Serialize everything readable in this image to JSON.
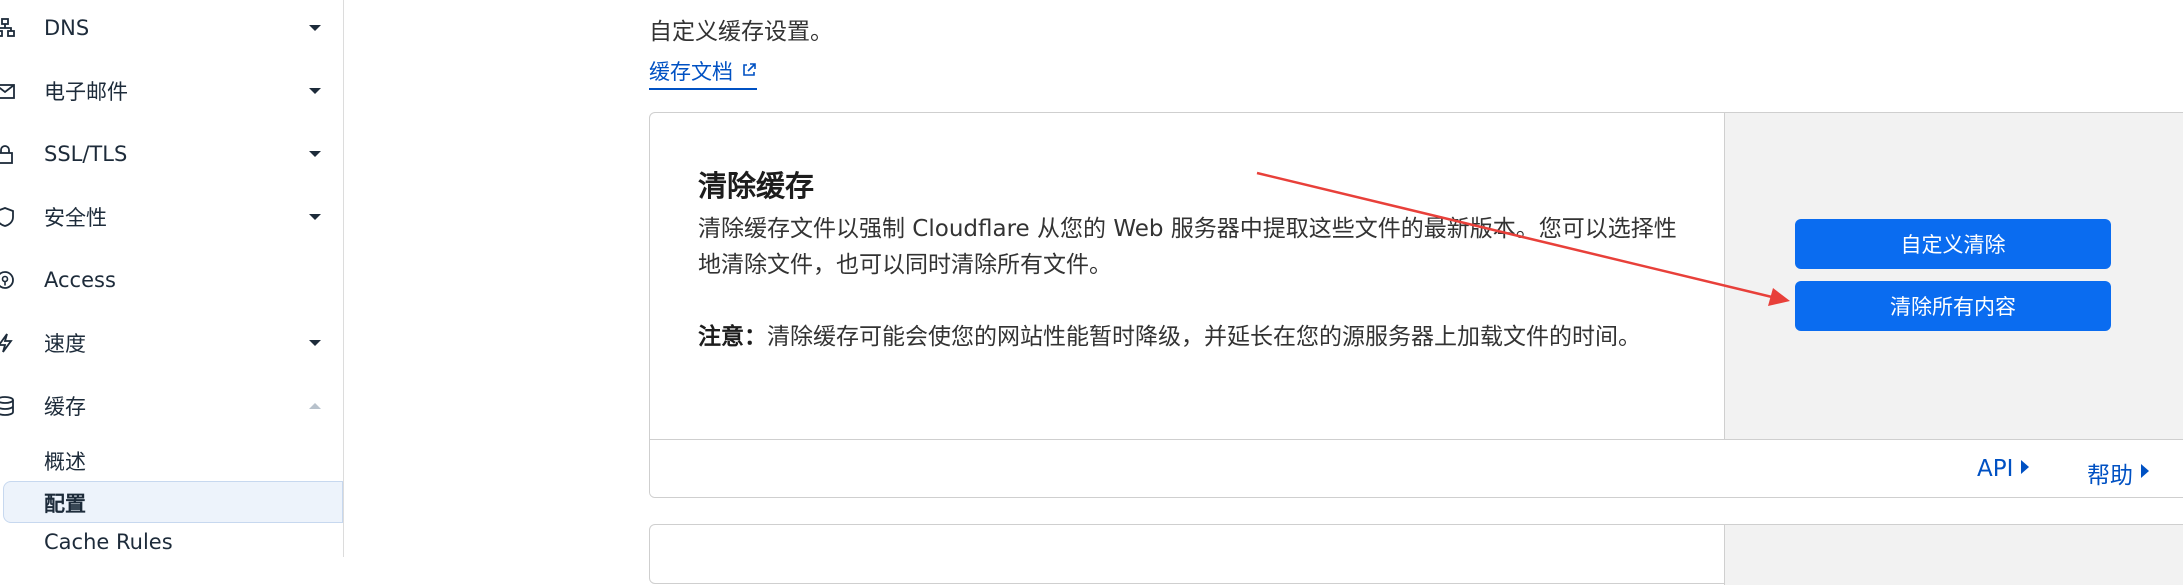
{
  "sidebar": {
    "items": [
      {
        "label": "DNS",
        "icon": "dns-icon",
        "has_chevron": true
      },
      {
        "label": "电子邮件",
        "icon": "mail-icon",
        "has_chevron": true
      },
      {
        "label": "SSL/TLS",
        "icon": "lock-icon",
        "has_chevron": true
      },
      {
        "label": "安全性",
        "icon": "shield-icon",
        "has_chevron": true
      },
      {
        "label": "Access",
        "icon": "access-icon",
        "has_chevron": false
      },
      {
        "label": "速度",
        "icon": "lightning-icon",
        "has_chevron": true
      },
      {
        "label": "缓存",
        "icon": "cache-icon",
        "has_chevron": true,
        "expanded": true
      }
    ],
    "sub_items": [
      {
        "label": "概述",
        "active": false
      },
      {
        "label": "配置",
        "active": true
      },
      {
        "label": "Cache Rules",
        "active": false
      }
    ],
    "active_color": "#edf3fb"
  },
  "main": {
    "intro": "自定义缓存设置。",
    "doc_link": "缓存文档",
    "card": {
      "title": "清除缓存",
      "description": "清除缓存文件以强制 Cloudflare 从您的 Web 服务器中提取这些文件的最新版本。您可以选择性地清除文件，也可以同时清除所有文件。",
      "note_label": "注意：",
      "note_text": "清除缓存可能会使您的网站性能暂时降级，并延长在您的源服务器上加载文件的时间。",
      "buttons": {
        "custom_purge": "自定义清除",
        "purge_everything": "清除所有内容"
      },
      "footer": {
        "api": "API",
        "help": "帮助"
      }
    }
  },
  "colors": {
    "primary_button": "#0a6cf0",
    "link": "#0051c3",
    "annotation_arrow": "#e8403a"
  }
}
